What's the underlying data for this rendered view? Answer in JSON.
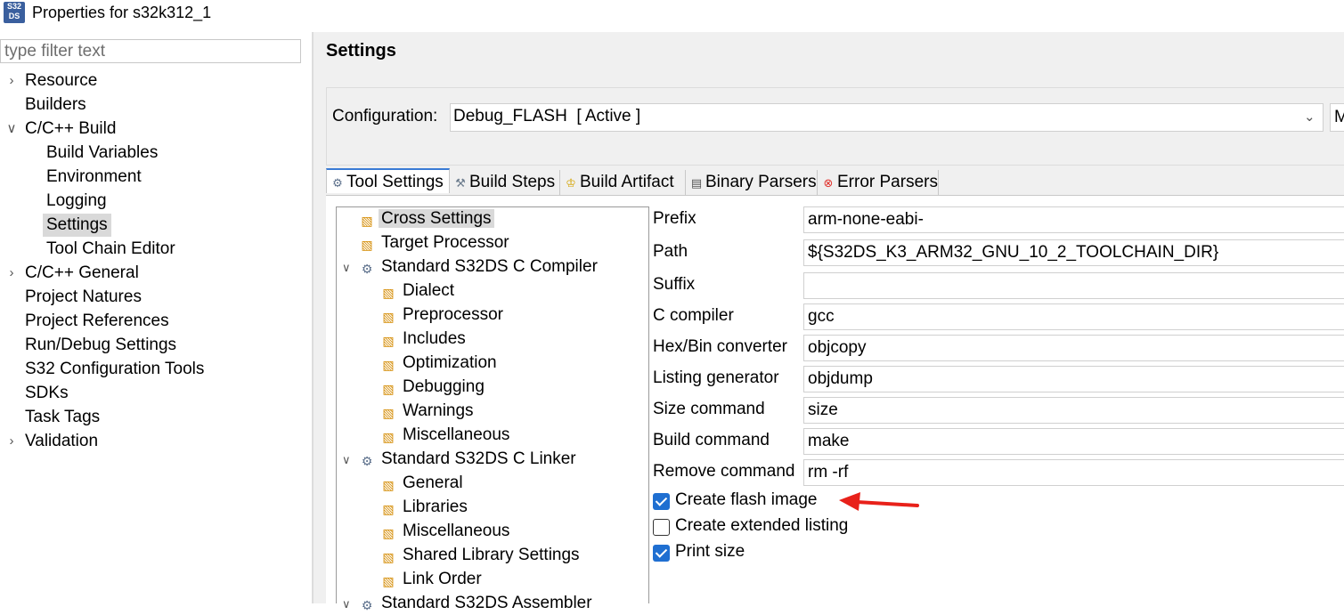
{
  "window": {
    "title": "Properties for s32k312_1",
    "app_icon_text": "S32\nDS"
  },
  "filter": {
    "placeholder": "type filter text",
    "value": ""
  },
  "nav": [
    {
      "label": "Resource",
      "chevron": "right"
    },
    {
      "label": "Builders"
    },
    {
      "label": "C/C++ Build",
      "chevron": "down"
    },
    {
      "label": "Build Variables"
    },
    {
      "label": "Environment"
    },
    {
      "label": "Logging"
    },
    {
      "label": "Settings",
      "selected": true
    },
    {
      "label": "Tool Chain Editor"
    },
    {
      "label": "C/C++ General",
      "chevron": "right"
    },
    {
      "label": "Project Natures"
    },
    {
      "label": "Project References"
    },
    {
      "label": "Run/Debug Settings"
    },
    {
      "label": "S32 Configuration Tools"
    },
    {
      "label": "SDKs"
    },
    {
      "label": "Task Tags"
    },
    {
      "label": "Validation",
      "chevron": "right"
    }
  ],
  "page_title": "Settings",
  "configuration": {
    "label": "Configuration:",
    "value": "Debug_FLASH  [ Active ]",
    "manage_label": "M"
  },
  "tabs": [
    {
      "label": "Tool Settings",
      "icon": "gear-icon",
      "active": true
    },
    {
      "label": "Build Steps",
      "icon": "wrench-icon"
    },
    {
      "label": "Build Artifact",
      "icon": "trophy-icon"
    },
    {
      "label": "Binary Parsers",
      "icon": "binary-icon"
    },
    {
      "label": "Error Parsers",
      "icon": "error-icon"
    }
  ],
  "tool_tree": [
    {
      "label": "Cross Settings",
      "icon": "folder-icon",
      "selected": true
    },
    {
      "label": "Target Processor",
      "icon": "folder-icon"
    },
    {
      "label": "Standard S32DS C Compiler",
      "icon": "gear-icon",
      "chevron": "down"
    },
    {
      "label": "Dialect",
      "icon": "folder-icon"
    },
    {
      "label": "Preprocessor",
      "icon": "folder-icon"
    },
    {
      "label": "Includes",
      "icon": "folder-icon"
    },
    {
      "label": "Optimization",
      "icon": "folder-icon"
    },
    {
      "label": "Debugging",
      "icon": "folder-icon"
    },
    {
      "label": "Warnings",
      "icon": "folder-icon"
    },
    {
      "label": "Miscellaneous",
      "icon": "folder-icon"
    },
    {
      "label": "Standard S32DS C Linker",
      "icon": "gear-icon",
      "chevron": "down"
    },
    {
      "label": "General",
      "icon": "folder-icon"
    },
    {
      "label": "Libraries",
      "icon": "folder-icon"
    },
    {
      "label": "Miscellaneous",
      "icon": "folder-icon"
    },
    {
      "label": "Shared Library Settings",
      "icon": "folder-icon"
    },
    {
      "label": "Link Order",
      "icon": "folder-icon"
    },
    {
      "label": "Standard S32DS Assembler",
      "icon": "gear-icon",
      "chevron": "down"
    }
  ],
  "fields": [
    {
      "label": "Prefix",
      "value": "arm-none-eabi-"
    },
    {
      "label": "Path",
      "value": "${S32DS_K3_ARM32_GNU_10_2_TOOLCHAIN_DIR}"
    },
    {
      "label": "Suffix",
      "value": ""
    },
    {
      "label": "C compiler",
      "value": "gcc"
    },
    {
      "label": "Hex/Bin converter",
      "value": "objcopy"
    },
    {
      "label": "Listing generator",
      "value": "objdump"
    },
    {
      "label": "Size command",
      "value": "size"
    },
    {
      "label": "Build command",
      "value": "make"
    },
    {
      "label": "Remove command",
      "value": "rm -rf"
    }
  ],
  "checkboxes": [
    {
      "label": "Create flash image",
      "checked": true
    },
    {
      "label": "Create extended listing",
      "checked": false
    },
    {
      "label": "Print size",
      "checked": true
    }
  ],
  "annotation_arrow_color": "#e8211a"
}
